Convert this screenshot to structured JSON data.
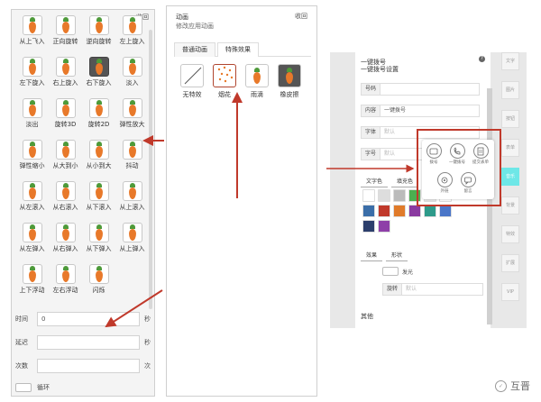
{
  "left_panel": {
    "collapse_label": "收回",
    "animations": [
      {
        "label": "从上飞入"
      },
      {
        "label": "正向旋转"
      },
      {
        "label": "逆向旋转"
      },
      {
        "label": "左上旋入"
      },
      {
        "label": "左下旋入"
      },
      {
        "label": "右上旋入"
      },
      {
        "label": "右下旋入"
      },
      {
        "label": "淡入"
      },
      {
        "label": "淡出"
      },
      {
        "label": "旋转3D"
      },
      {
        "label": "旋转2D"
      },
      {
        "label": "弹性放大"
      },
      {
        "label": "弹性缩小"
      },
      {
        "label": "从大到小"
      },
      {
        "label": "从小到大"
      },
      {
        "label": "抖动"
      },
      {
        "label": "从左滚入"
      },
      {
        "label": "从右滚入"
      },
      {
        "label": "从下滚入"
      },
      {
        "label": "从上滚入"
      },
      {
        "label": "从左弹入"
      },
      {
        "label": "从右弹入"
      },
      {
        "label": "从下弹入"
      },
      {
        "label": "从上弹入"
      },
      {
        "label": "上下浮动"
      },
      {
        "label": "左右浮动"
      },
      {
        "label": "闪烁"
      }
    ],
    "time": {
      "label": "时间",
      "value": "0",
      "unit": "秒"
    },
    "delay": {
      "label": "延迟",
      "value": "",
      "unit": "秒"
    },
    "count": {
      "label": "次数",
      "value": "",
      "unit": "次"
    },
    "loop": {
      "label": "循环"
    }
  },
  "middle_panel": {
    "title": "动画",
    "subtitle": "修改应用动画",
    "collapse_label": "收回",
    "tabs": [
      {
        "label": "普通动画"
      },
      {
        "label": "特殊效果"
      }
    ],
    "effects": [
      {
        "label": "无特效"
      },
      {
        "label": "烟花"
      },
      {
        "label": "雨滴"
      },
      {
        "label": "橡皮擦"
      }
    ]
  },
  "right_panel": {
    "title": "一键拨号",
    "subtitle": "一键拨号设置",
    "help_label": "?",
    "fields": [
      {
        "label": "号码",
        "value": ""
      },
      {
        "label": "内容",
        "value": "一键拨号"
      },
      {
        "label": "字体",
        "value": "默认"
      },
      {
        "label": "字号",
        "value": "默认"
      }
    ],
    "style_tabs": [
      {
        "label": "文字色"
      },
      {
        "label": "填充色"
      }
    ],
    "swatches": [
      "#ffffff",
      "#dddddd",
      "#bbbbbb",
      "#4caf50",
      "#e8e8e8",
      "#ffffff",
      "#3b6ea8",
      "#c0392b",
      "#e07b2a",
      "#8a3aa0",
      "#2e9a8a",
      "#4a76c8",
      "#2c3e6b",
      "#8e3fa8"
    ],
    "effect_tabs": [
      {
        "label": "效果"
      },
      {
        "label": "形状"
      }
    ],
    "glow_label": "发光",
    "glow_sub": "旋转",
    "glow_value": "默认",
    "other_label": "其他",
    "side_buttons": [
      {
        "label": "文字"
      },
      {
        "label": "图片"
      },
      {
        "label": "按钮"
      },
      {
        "label": "表单"
      },
      {
        "label": "音乐"
      },
      {
        "label": "背景"
      },
      {
        "label": "特效"
      },
      {
        "label": "扩展"
      },
      {
        "label": "VIP"
      }
    ],
    "popup_items": [
      {
        "label": "拨号",
        "icon": "phone-icon"
      },
      {
        "label": "一键拨号",
        "icon": "dial-icon"
      },
      {
        "label": "提交表单",
        "icon": "form-icon"
      },
      {
        "label": "外链",
        "icon": "link-icon"
      },
      {
        "label": "留言",
        "icon": "comment-icon"
      }
    ]
  },
  "watermark": {
    "text": "互晋"
  },
  "colors": {
    "arrow": "#c0392b",
    "accent": "#6ee7e7",
    "carrot": "#e8792a",
    "leaf": "#4e9a3a"
  }
}
